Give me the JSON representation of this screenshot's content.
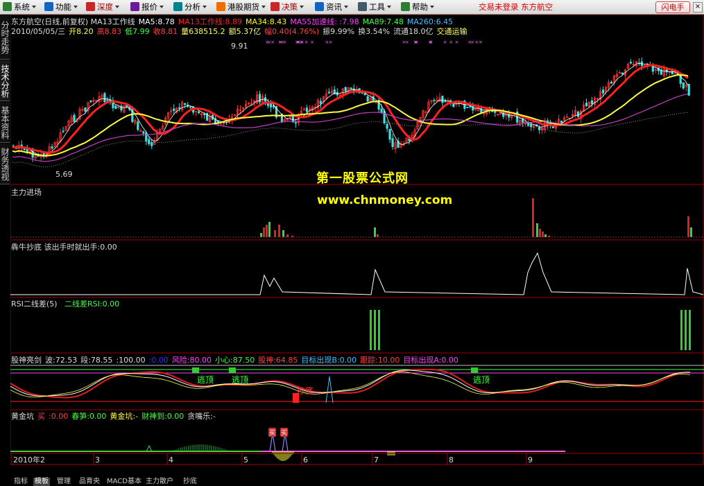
{
  "menu": [
    {
      "label": "系统",
      "color": "#2e7d32"
    },
    {
      "label": "功能",
      "color": "#1565c0"
    },
    {
      "label": "深度",
      "color": "#c62828",
      "highlight": true
    },
    {
      "label": "报价",
      "color": "#6a1b9a"
    },
    {
      "label": "分析",
      "color": "#00838f"
    },
    {
      "label": "港股期货",
      "color": "#ef6c00"
    },
    {
      "label": "决策",
      "color": "#c62828",
      "highlight": true
    },
    {
      "label": "资讯",
      "color": "#1565c0"
    },
    {
      "label": "工具",
      "color": "#455a64"
    },
    {
      "label": "帮助",
      "color": "#2e7d32"
    }
  ],
  "status_text": "交易未登录  东方航空",
  "flash_button": "闪电手",
  "close_button": "×",
  "side_tabs": [
    "分时走势",
    "技术分析",
    "基本资料",
    "财务透视"
  ],
  "main": {
    "line1": [
      {
        "t": "东方航空(日线,前复权) MA13工作线",
        "c": "#dcdcdc"
      },
      {
        "t": "MA5:8.78",
        "c": "#ffffff"
      },
      {
        "t": "MA13工作线:8.89",
        "c": "#ff2020"
      },
      {
        "t": "MA34:8.43",
        "c": "#ffff00"
      },
      {
        "t": "MA55加速线: :7.98",
        "c": "#ff40ff"
      },
      {
        "t": "MA89:7.48",
        "c": "#40ff40"
      },
      {
        "t": "MA260:6.45",
        "c": "#40c0ff"
      }
    ],
    "line2": [
      {
        "t": "2010/05/05/三",
        "c": "#dcdcdc"
      },
      {
        "t": "开8.20",
        "c": "#ffff60"
      },
      {
        "t": "高8.83",
        "c": "#ff4040"
      },
      {
        "t": "低7.99",
        "c": "#40ff40"
      },
      {
        "t": "收8.81",
        "c": "#ff4040"
      },
      {
        "t": "量638515.2",
        "c": "#ffff60"
      },
      {
        "t": "额5.37亿",
        "c": "#ffff60"
      },
      {
        "t": "幅0.40(4.76%)",
        "c": "#ff4040"
      },
      {
        "t": "振9.99%",
        "c": "#dcdcdc"
      },
      {
        "t": "换3.54%",
        "c": "#dcdcdc"
      },
      {
        "t": "流通18.0亿",
        "c": "#dcdcdc"
      },
      {
        "t": "交通运输",
        "c": "#ffff60"
      }
    ],
    "high_marker": "9.91",
    "low_marker": "5.69"
  },
  "watermark": {
    "title": "第一股票公式网",
    "url": "www.chnmoney.com"
  },
  "pane2": {
    "title": "主力进场"
  },
  "pane3": {
    "title": "犇牛抄底 该出手时就出手:0.00"
  },
  "pane4": {
    "title": "RSI二线差(5)",
    "value": "二线差RSI:0.00"
  },
  "pane5": [
    {
      "t": "股神亮剑",
      "c": "#dcdcdc"
    },
    {
      "t": "波:72.53",
      "c": "#dcdcdc"
    },
    {
      "t": "段:78.55",
      "c": "#dcdcdc"
    },
    {
      "t": ":100.00",
      "c": "#dcdcdc"
    },
    {
      "t": ":0.00",
      "c": "#3030ff"
    },
    {
      "t": "风险:80.00",
      "c": "#ff40ff"
    },
    {
      "t": "小心:87.50",
      "c": "#40ff40"
    },
    {
      "t": "股神:64.85",
      "c": "#ff4040"
    },
    {
      "t": "目标出现B:0.00",
      "c": "#40c0ff"
    },
    {
      "t": "跟踪:10.00",
      "c": "#ff4040"
    },
    {
      "t": "目标出现A:0.00",
      "c": "#ff40ff"
    }
  ],
  "pane5_labels": {
    "escape1": "逃顶",
    "escape2": "逃顶",
    "escape3": "逃顶",
    "bottom": "抄底"
  },
  "pane6": [
    {
      "t": "黄金坑",
      "c": "#dcdcdc"
    },
    {
      "t": "买",
      "c": "#ff4040"
    },
    {
      "t": ":0.00",
      "c": "#ff4040"
    },
    {
      "t": "春笋:0.00",
      "c": "#40ff40"
    },
    {
      "t": "黄金坑:-",
      "c": "#ffff40"
    },
    {
      "t": "财神到:0.00",
      "c": "#40ff40"
    },
    {
      "t": "贪嘴乐:-",
      "c": "#dcdcdc"
    }
  ],
  "pane6_badges": [
    "买",
    "买"
  ],
  "x_axis": [
    "2010年2",
    "3",
    "4",
    "5",
    "6",
    "7",
    "8",
    "9"
  ],
  "bottom_tabs": [
    "指标",
    "模板",
    "管理",
    "品育央",
    "MACD基本",
    "主力散户",
    "抄底"
  ]
}
